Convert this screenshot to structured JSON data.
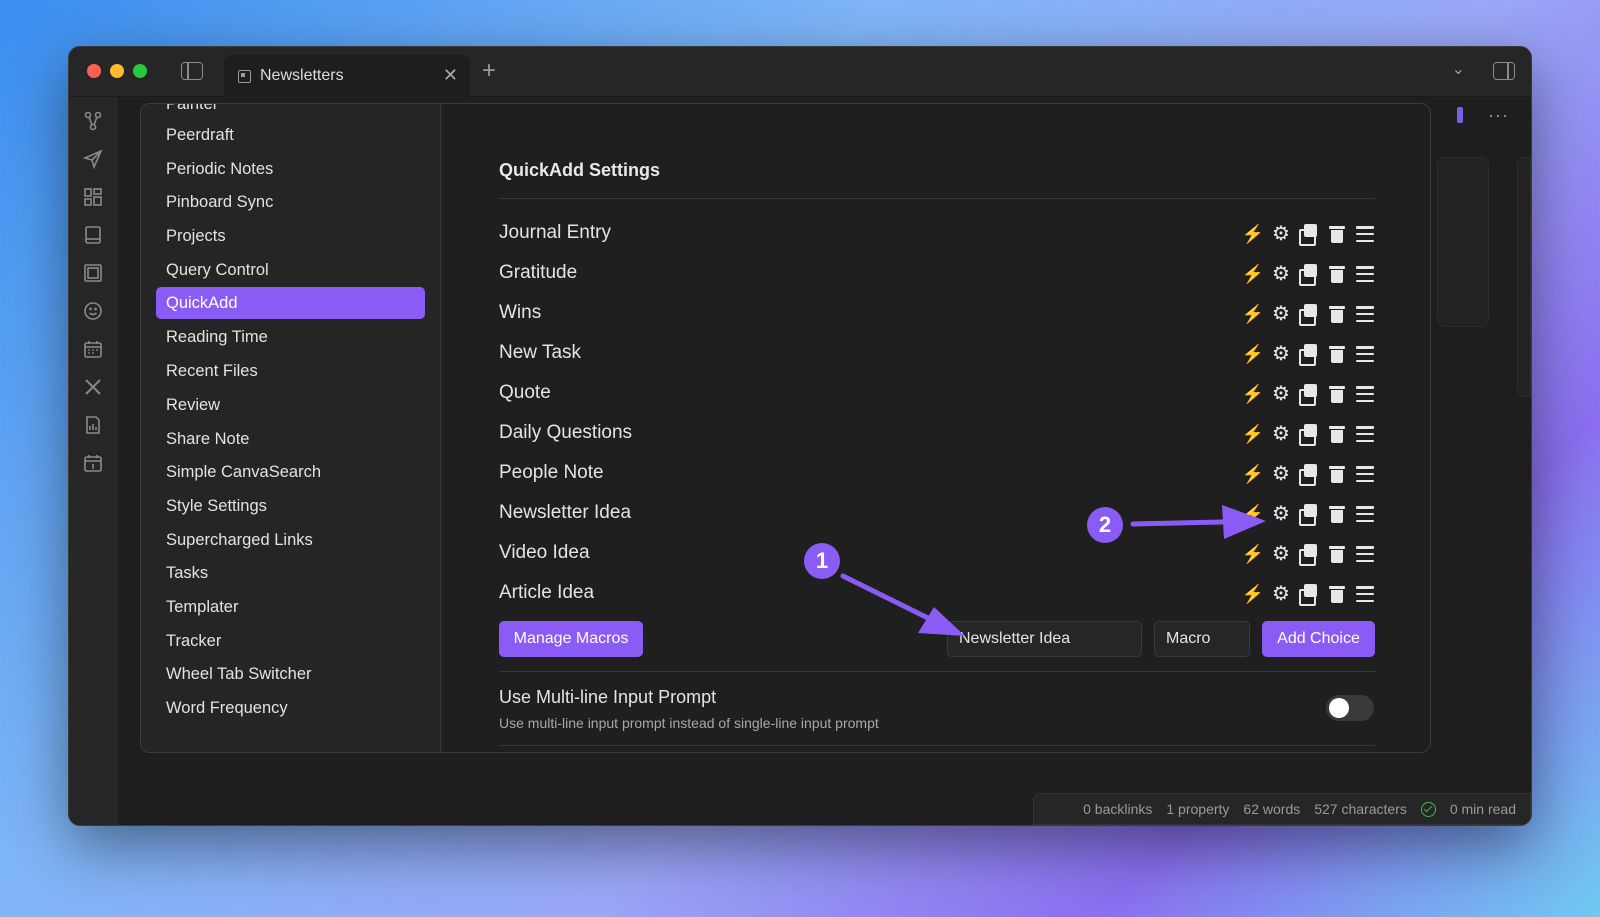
{
  "window": {
    "tab_title": "Newsletters",
    "tab_close": "✕",
    "new_tab": "+",
    "chevron": "⌄",
    "more": "···"
  },
  "ribbon_icons": [
    "graph-icon",
    "send-icon",
    "grid-icon",
    "book-icon",
    "gallery-icon",
    "smiley-icon",
    "calendar-icon",
    "tools-icon",
    "report-icon",
    "daily-note-icon"
  ],
  "settings_sidebar": {
    "items": [
      {
        "label": "Painter"
      },
      {
        "label": "Peerdraft"
      },
      {
        "label": "Periodic Notes"
      },
      {
        "label": "Pinboard Sync"
      },
      {
        "label": "Projects"
      },
      {
        "label": "Query Control"
      },
      {
        "label": "QuickAdd"
      },
      {
        "label": "Reading Time"
      },
      {
        "label": "Recent Files"
      },
      {
        "label": "Review"
      },
      {
        "label": "Share Note"
      },
      {
        "label": "Simple CanvaSearch"
      },
      {
        "label": "Style Settings"
      },
      {
        "label": "Supercharged Links"
      },
      {
        "label": "Tasks"
      },
      {
        "label": "Templater"
      },
      {
        "label": "Tracker"
      },
      {
        "label": "Wheel Tab Switcher"
      },
      {
        "label": "Word Frequency"
      }
    ],
    "active": "QuickAdd"
  },
  "quickadd": {
    "heading": "QuickAdd Settings",
    "choices": [
      {
        "label": "Journal Entry"
      },
      {
        "label": "Gratitude"
      },
      {
        "label": "Wins"
      },
      {
        "label": "New Task"
      },
      {
        "label": "Quote"
      },
      {
        "label": "Daily Questions"
      },
      {
        "label": "People Note"
      },
      {
        "label": "Newsletter Idea"
      },
      {
        "label": "Video Idea"
      },
      {
        "label": "Article Idea"
      }
    ],
    "action_icons": [
      "lightning-icon",
      "gear-icon",
      "duplicate-icon",
      "trash-icon",
      "drag-handle-icon"
    ],
    "manage_macros_label": "Manage Macros",
    "new_choice_value": "Newsletter Idea",
    "choice_type_value": "Macro",
    "add_choice_label": "Add Choice",
    "option": {
      "title": "Use Multi-line Input Prompt",
      "description": "Use multi-line input prompt instead of single-line input prompt",
      "enabled": false
    }
  },
  "annotations": {
    "badge_1": "1",
    "badge_2": "2",
    "accent_color": "#8a5cf5"
  },
  "status_bar": {
    "backlinks": "0 backlinks",
    "property": "1 property",
    "words": "62 words",
    "characters": "527 characters",
    "read_time": "0 min read"
  },
  "colors": {
    "accent": "#8a5cf5",
    "lightning": "#f5c518",
    "sync_ok": "#3fb950"
  }
}
